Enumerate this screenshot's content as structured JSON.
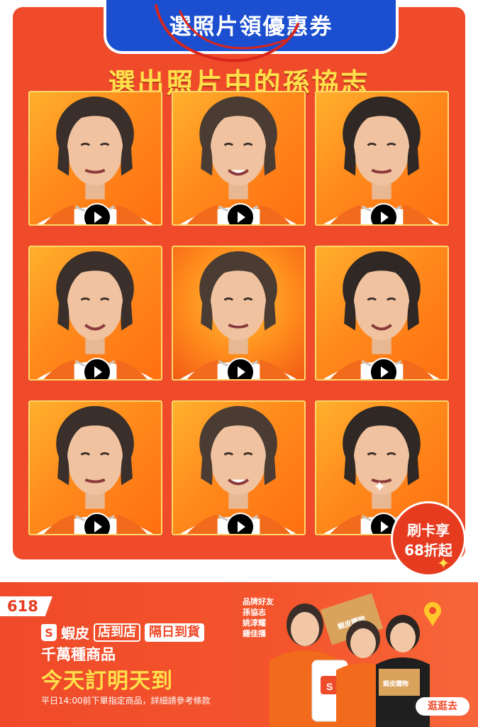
{
  "quiz": {
    "tab_title": "選照片領優惠券",
    "title": "選出照片中的孫協志",
    "photos": [
      {
        "alt_label": "photo-1"
      },
      {
        "alt_label": "photo-2"
      },
      {
        "alt_label": "photo-3"
      },
      {
        "alt_label": "photo-4"
      },
      {
        "alt_label": "photo-5"
      },
      {
        "alt_label": "photo-6"
      },
      {
        "alt_label": "photo-7"
      },
      {
        "alt_label": "photo-8"
      },
      {
        "alt_label": "photo-9"
      }
    ],
    "promo_badge": {
      "line1": "刷卡享",
      "line2": "68折起"
    },
    "colors": {
      "card_bg": "#ef4a2a",
      "tab_bg": "#1b4fd0",
      "title": "#ffe04a"
    }
  },
  "banner": {
    "event_badge": "618",
    "brand": "蝦皮",
    "chip_store": "店到店",
    "chip_nextday": "隔日到貨",
    "line1": "千萬種商品",
    "line2": "今天訂明天到",
    "note": "平日14:00前下單指定商品，詳細請參考條款",
    "endorsers": [
      "品牌好友",
      "孫協志",
      "姚淳耀",
      "鍾佳播"
    ],
    "box_label": "蝦皮購物",
    "go_button": "逛逛去"
  },
  "icons": [
    "play-icon",
    "shopee-logo-icon",
    "sparkle-icon",
    "location-pin-icon"
  ]
}
